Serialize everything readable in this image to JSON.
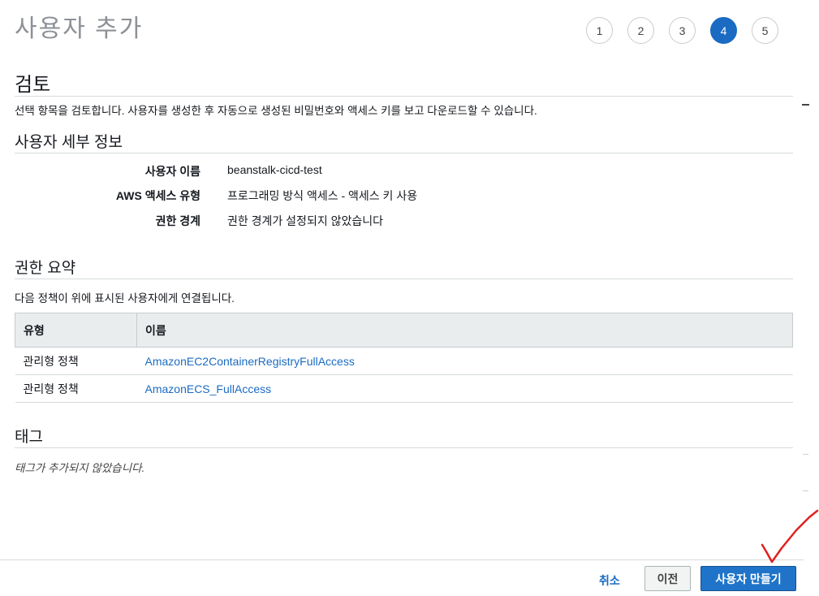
{
  "page": {
    "title": "사용자 추가"
  },
  "steps": [
    "1",
    "2",
    "3",
    "4",
    "5"
  ],
  "active_step": "4",
  "review": {
    "heading": "검토",
    "description": "선택 항목을 검토합니다. 사용자를 생성한 후 자동으로 생성된 비밀번호와 액세스 키를 보고 다운로드할 수 있습니다."
  },
  "user_details": {
    "heading": "사용자 세부 정보",
    "rows": [
      {
        "key": "사용자 이름",
        "value": "beanstalk-cicd-test"
      },
      {
        "key": "AWS 액세스 유형",
        "value": "프로그래밍 방식 액세스 - 액세스 키 사용"
      },
      {
        "key": "권한 경계",
        "value": "권한 경계가 설정되지 않았습니다"
      }
    ]
  },
  "permissions": {
    "heading": "권한 요약",
    "description": "다음 정책이 위에 표시된 사용자에게 연결됩니다.",
    "columns": [
      "유형",
      "이름"
    ],
    "rows": [
      {
        "type": "관리형 정책",
        "name": "AmazonEC2ContainerRegistryFullAccess"
      },
      {
        "type": "관리형 정책",
        "name": "AmazonECS_FullAccess"
      }
    ]
  },
  "tags": {
    "heading": "태그",
    "empty_text": "태그가 추가되지 않았습니다."
  },
  "footer": {
    "cancel_label": "취소",
    "previous_label": "이전",
    "create_label": "사용자 만들기"
  },
  "colors": {
    "accent": "#1b6bc2",
    "primary_button": "#1f74c9",
    "annotation": "#e02020"
  }
}
